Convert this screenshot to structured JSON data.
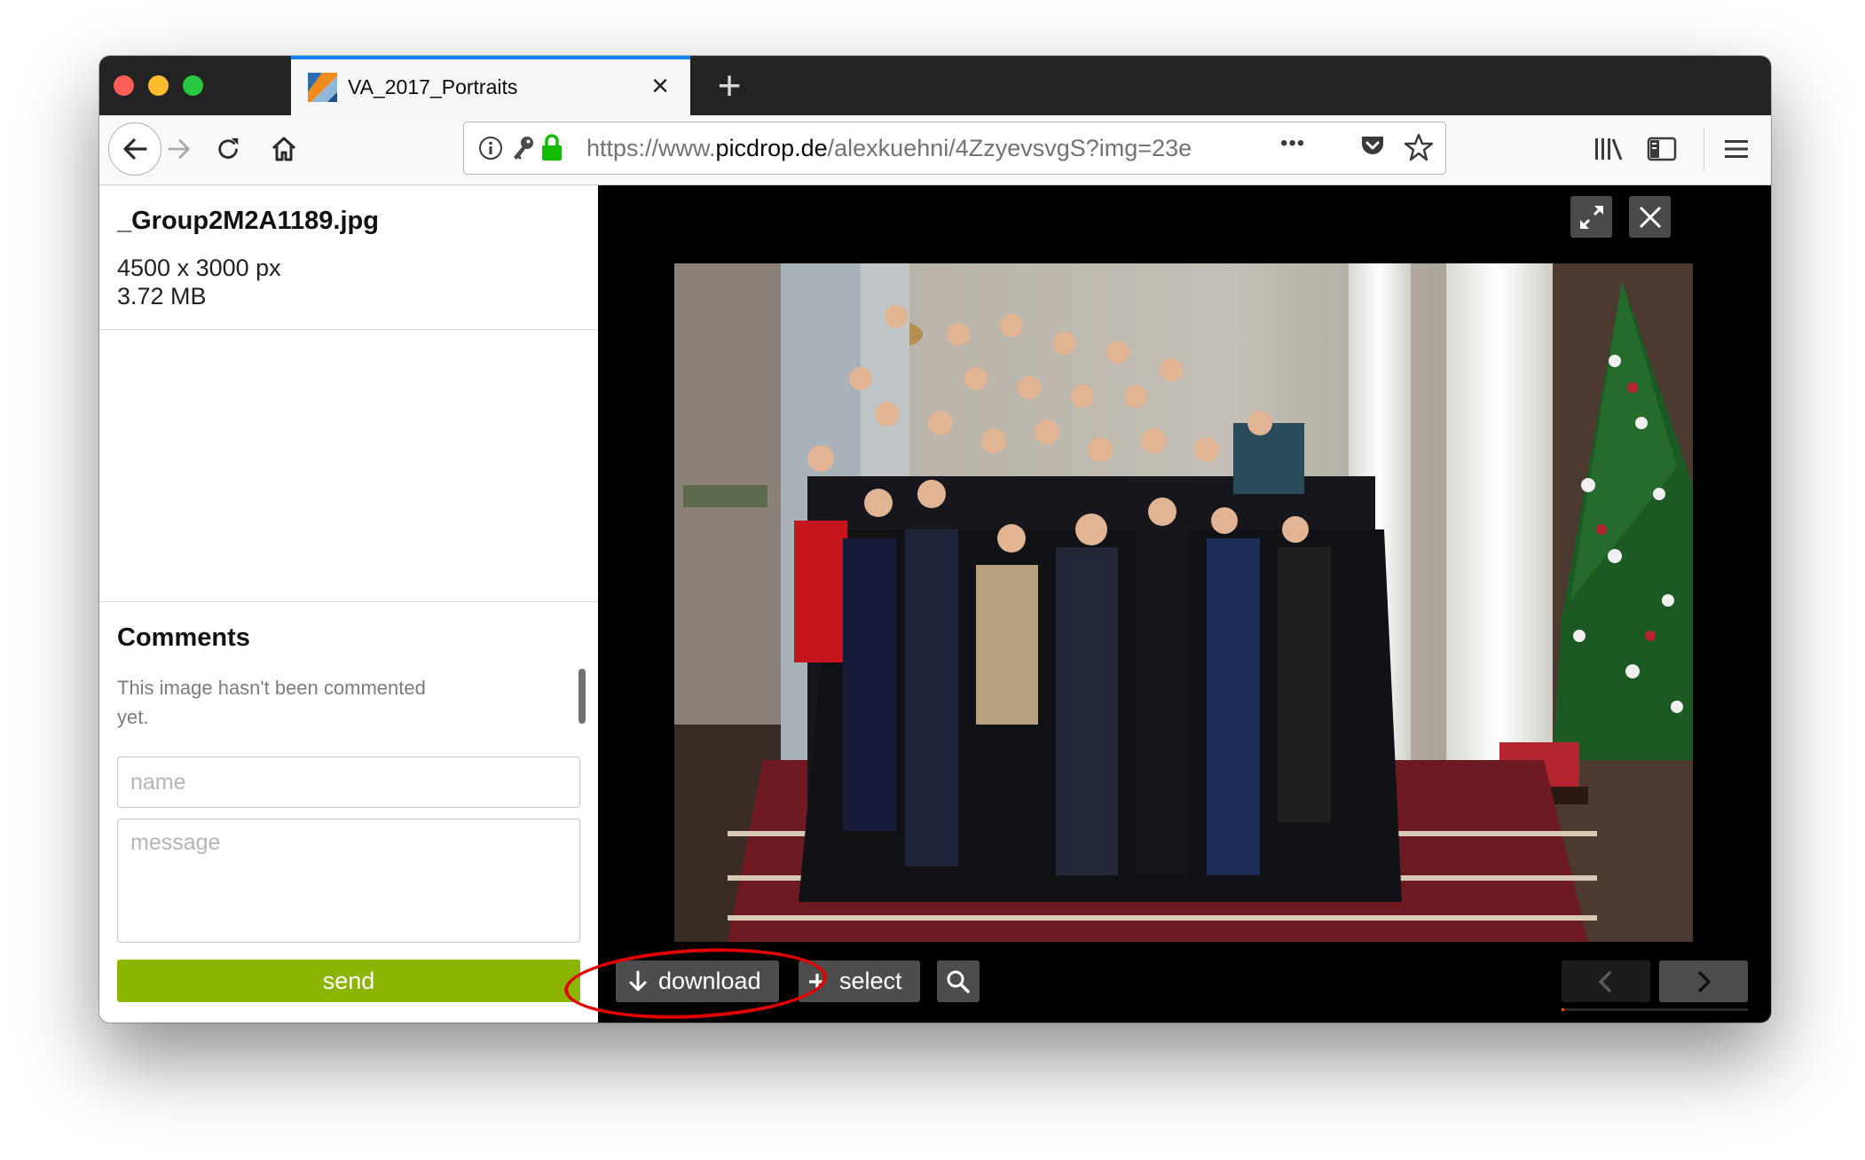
{
  "browser": {
    "tab_title": "VA_2017_Portraits",
    "new_tab_symbol": "+",
    "url_prefix": "https://www.",
    "url_host": "picdrop.de",
    "url_path": "/alexkuehni/4ZzyevsvgS?img=23e",
    "page_actions_symbol": "•••"
  },
  "file": {
    "name": "_Group2M2A1189.jpg",
    "dimensions": "4500 x 3000 px",
    "size": "3.72 MB"
  },
  "comments": {
    "title": "Comments",
    "empty_text": "This image hasn't been commented yet.",
    "name_placeholder": "name",
    "message_placeholder": "message",
    "send_label": "send"
  },
  "viewer": {
    "download_label": "download",
    "select_label": "select",
    "fullscreen_icon": "expand-icon",
    "close_icon": "close-icon",
    "zoom_icon": "magnifier-icon",
    "prev_icon": "chevron-left-icon",
    "next_icon": "chevron-right-icon",
    "progress": 0.015
  },
  "colors": {
    "send_button": "#8bb500",
    "annotation": "#e00000",
    "tab_accent": "#0a84ff",
    "secure_lock": "#12bc00"
  }
}
